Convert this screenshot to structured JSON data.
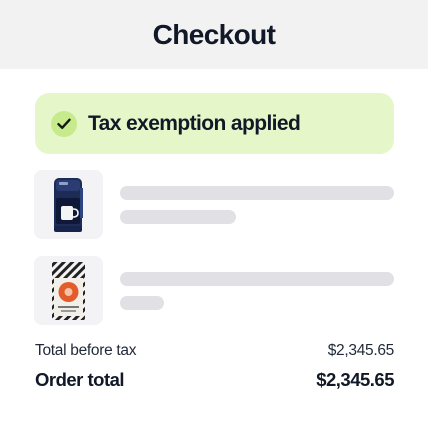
{
  "header": {
    "title": "Checkout"
  },
  "banner": {
    "text": "Tax exemption applied",
    "icon": "check-icon",
    "bg_color": "#e5f7c8"
  },
  "items": [
    {
      "image": "coffee-maker-icon"
    },
    {
      "image": "coffee-pack-icon"
    }
  ],
  "summary": {
    "subtotal_label": "Total before tax",
    "subtotal_value": "$2,345.65",
    "total_label": "Order total",
    "total_value": "$2,345.65"
  }
}
